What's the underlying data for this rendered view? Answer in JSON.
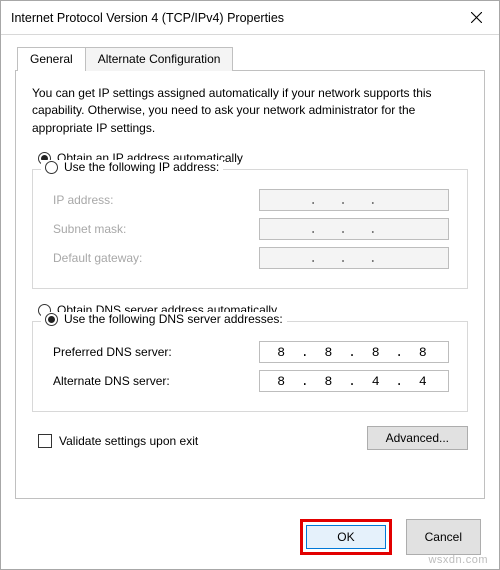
{
  "window": {
    "title": "Internet Protocol Version 4 (TCP/IPv4) Properties"
  },
  "tabs": {
    "general": "General",
    "alternate": "Alternate Configuration"
  },
  "description": "You can get IP settings assigned automatically if your network supports this capability. Otherwise, you need to ask your network administrator for the appropriate IP settings.",
  "ip": {
    "auto_label": "Obtain an IP address automatically",
    "manual_label": "Use the following IP address:",
    "selected": "auto",
    "fields": {
      "address_label": "IP address:",
      "subnet_label": "Subnet mask:",
      "gateway_label": "Default gateway:",
      "address": "",
      "subnet": "",
      "gateway": ""
    }
  },
  "dns": {
    "auto_label": "Obtain DNS server address automatically",
    "manual_label": "Use the following DNS server addresses:",
    "selected": "manual",
    "fields": {
      "preferred_label": "Preferred DNS server:",
      "alternate_label": "Alternate DNS server:",
      "preferred": "8 . 8 . 8 . 8",
      "alternate": "8 . 8 . 4 . 4"
    }
  },
  "validate_label": "Validate settings upon exit",
  "validate_checked": false,
  "buttons": {
    "advanced": "Advanced...",
    "ok": "OK",
    "cancel": "Cancel"
  },
  "watermark": "wsxdn.com"
}
